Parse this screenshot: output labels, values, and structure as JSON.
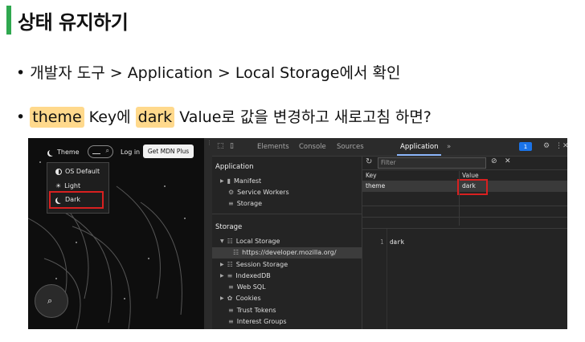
{
  "slide": {
    "title": "상태 유지하기",
    "bullet1": "개발자 도구 > Application > Local Storage에서 확인",
    "bullet2": {
      "theme": "theme",
      "key_text": " Key에 ",
      "dark": "dark",
      "value_text": " Value로 값을 변경하고 새로고침 하면?"
    },
    "colors": {
      "accent_bar": "#2fa84f",
      "highlight": "#ffd98c",
      "annotation": "#d82020"
    }
  },
  "site": {
    "theme_button": "Theme",
    "login": "Log in",
    "mdn_plus": "Get MDN Plus",
    "search_icon": "search-icon",
    "menu": {
      "os_default": "OS Default",
      "light": "Light",
      "dark": "Dark"
    },
    "circle_search_icon": "search-icon"
  },
  "devtools": {
    "tabs": [
      "Elements",
      "Console",
      "Sources",
      "Application"
    ],
    "more_tabs": "»",
    "message_count": "1",
    "tree": {
      "application_header": "Application",
      "manifest": "Manifest",
      "service_workers": "Service Workers",
      "storage_item": "Storage",
      "storage_header": "Storage",
      "local_storage": "Local Storage",
      "local_storage_origin": "https://developer.mozilla.org/",
      "session_storage": "Session Storage",
      "indexeddb": "IndexedDB",
      "websql": "Web SQL",
      "cookies": "Cookies",
      "trust_tokens": "Trust Tokens",
      "interest_groups": "Interest Groups"
    },
    "filter_placeholder": "Filter",
    "columns": {
      "key": "Key",
      "value": "Value"
    },
    "row": {
      "key": "theme",
      "value": "dark"
    },
    "preview": {
      "line_number": "1",
      "text": "dark"
    }
  }
}
